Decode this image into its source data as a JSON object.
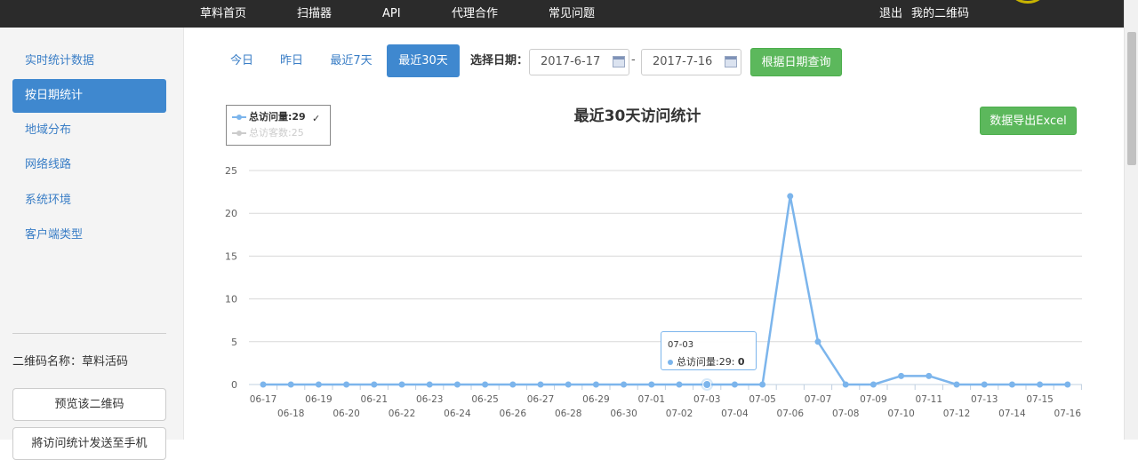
{
  "topnav": {
    "items": [
      "草料首页",
      "扫描器",
      "API",
      "代理合作",
      "常见问题"
    ],
    "logout": "退出",
    "my_qrcodes": "我的二维码"
  },
  "sidebar": {
    "items": [
      "实时统计数据",
      "按日期统计",
      "地域分布",
      "网络线路",
      "系统环境",
      "客户端类型"
    ],
    "active_index": 1,
    "qr_name": "二维码名称：草料活码",
    "preview_button": "预览该二维码",
    "bottom_button": "將访问统计发送至手机"
  },
  "toolbar": {
    "tabs": [
      "今日",
      "昨日",
      "最近7天",
      "最近30天"
    ],
    "active_tab": 3,
    "date_label": "选择日期：",
    "start_date": "2017-6-17",
    "date_separator": "-",
    "end_date": "2017-7-16",
    "query_button": "根据日期查询",
    "export_button": "数据导出Excel"
  },
  "colors": {
    "accent": "#3f88cf",
    "green": "#5cb85c",
    "series": "#7cb5ec",
    "series_hidden": "#cccccc"
  },
  "chart_data": {
    "type": "line",
    "title": "最近30天访问统计",
    "categories": [
      "06-17",
      "06-18",
      "06-19",
      "06-20",
      "06-21",
      "06-22",
      "06-23",
      "06-24",
      "06-25",
      "06-26",
      "06-27",
      "06-28",
      "06-29",
      "06-30",
      "07-01",
      "07-02",
      "07-03",
      "07-04",
      "07-05",
      "07-06",
      "07-07",
      "07-08",
      "07-09",
      "07-10",
      "07-11",
      "07-12",
      "07-13",
      "07-14",
      "07-15",
      "07-16"
    ],
    "series": [
      {
        "name": "总访问量",
        "legend": "总访问量:29",
        "visible": true,
        "checked": true,
        "values": [
          0,
          0,
          0,
          0,
          0,
          0,
          0,
          0,
          0,
          0,
          0,
          0,
          0,
          0,
          0,
          0,
          0,
          0,
          0,
          22,
          5,
          0,
          0,
          1,
          1,
          0,
          0,
          0,
          0,
          0
        ]
      },
      {
        "name": "总访客数",
        "legend": "总访客数:25",
        "visible": false,
        "checked": false
      }
    ],
    "ylim": [
      0,
      25
    ],
    "yticks": [
      0,
      5,
      10,
      15,
      20,
      25
    ],
    "grid": true,
    "legend_position": "top-left",
    "tooltip": {
      "category": "07-03",
      "series_label": "总访问量:29:",
      "value": "0",
      "index": 16
    }
  }
}
